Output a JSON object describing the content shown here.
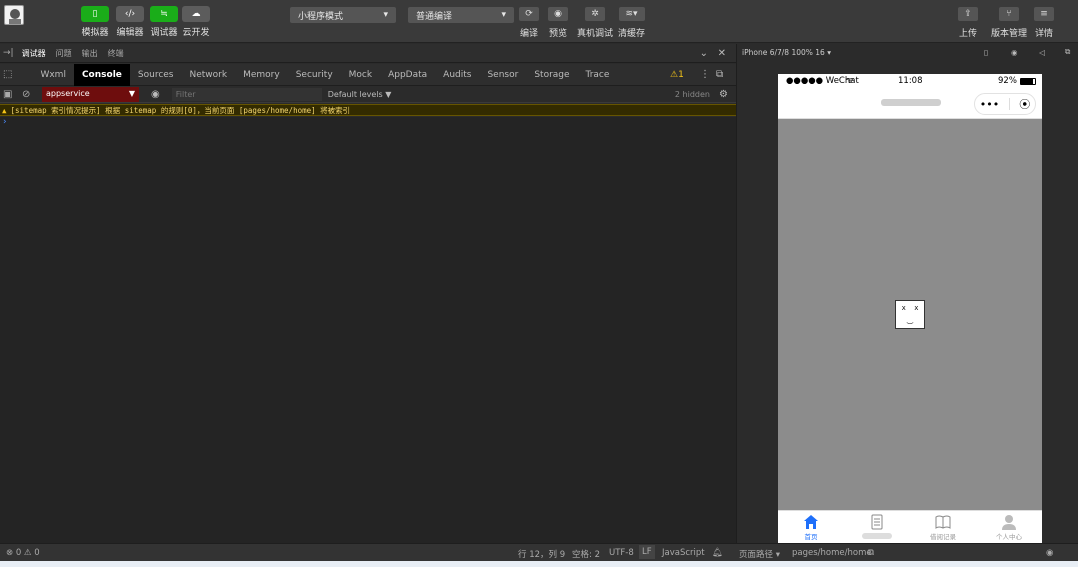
{
  "toolbar": {
    "buttons": [
      {
        "label": "模拟器"
      },
      {
        "label": "编辑器"
      },
      {
        "label": "调试器"
      },
      {
        "label": "云开发"
      }
    ],
    "mode_select": "小程序模式",
    "compile_select": "普通编译",
    "actions": [
      {
        "label": "编译"
      },
      {
        "label": "预览"
      },
      {
        "label": "真机调试"
      },
      {
        "label": "清缓存"
      }
    ],
    "right_actions": [
      {
        "label": "上传"
      },
      {
        "label": "版本管理"
      },
      {
        "label": "详情"
      }
    ]
  },
  "devtools": {
    "header_tabs": [
      "调试器",
      "问题",
      "输出",
      "终端"
    ],
    "tabs": [
      "Wxml",
      "Console",
      "Sources",
      "Network",
      "Memory",
      "Security",
      "Mock",
      "AppData",
      "Audits",
      "Sensor",
      "Storage",
      "Trace"
    ],
    "warn_count": "1",
    "context": "appservice",
    "filter_placeholder": "Filter",
    "levels": "Default levels ▼",
    "hidden_count": "2 hidden",
    "warning_message": "[sitemap 索引情况提示] 根据 sitemap 的规则[0]，当前页面 [pages/home/home] 将被索引"
  },
  "simulator": {
    "device": "iPhone 6/7/8 100% 16 ▾",
    "status": {
      "carrier": "●●●●● WeChat",
      "time": "11:08",
      "battery": "92%"
    },
    "capsule_more": "•••",
    "error_face": "x x\n  \n︶",
    "tabbar": [
      {
        "label": "首页",
        "icon": "home-icon"
      },
      {
        "label": "",
        "icon": "document-icon"
      },
      {
        "label": "借阅记录",
        "icon": "book-icon"
      },
      {
        "label": "个人中心",
        "icon": "user-icon"
      }
    ]
  },
  "statusbar": {
    "problems": "⊗ 0 ⚠ 0",
    "cursor": "行 12，列 9",
    "spaces": "空格: 2",
    "encoding": "UTF-8",
    "eol": "LF",
    "language": "JavaScript",
    "page_path_label": "页面路径 ▾",
    "page_path": "pages/home/home"
  },
  "colors": {
    "accent_green": "#1aad19",
    "tab_active_blue": "#1e6ffa",
    "warn_bg": "#332b00",
    "context_red": "#6e0d0d"
  }
}
